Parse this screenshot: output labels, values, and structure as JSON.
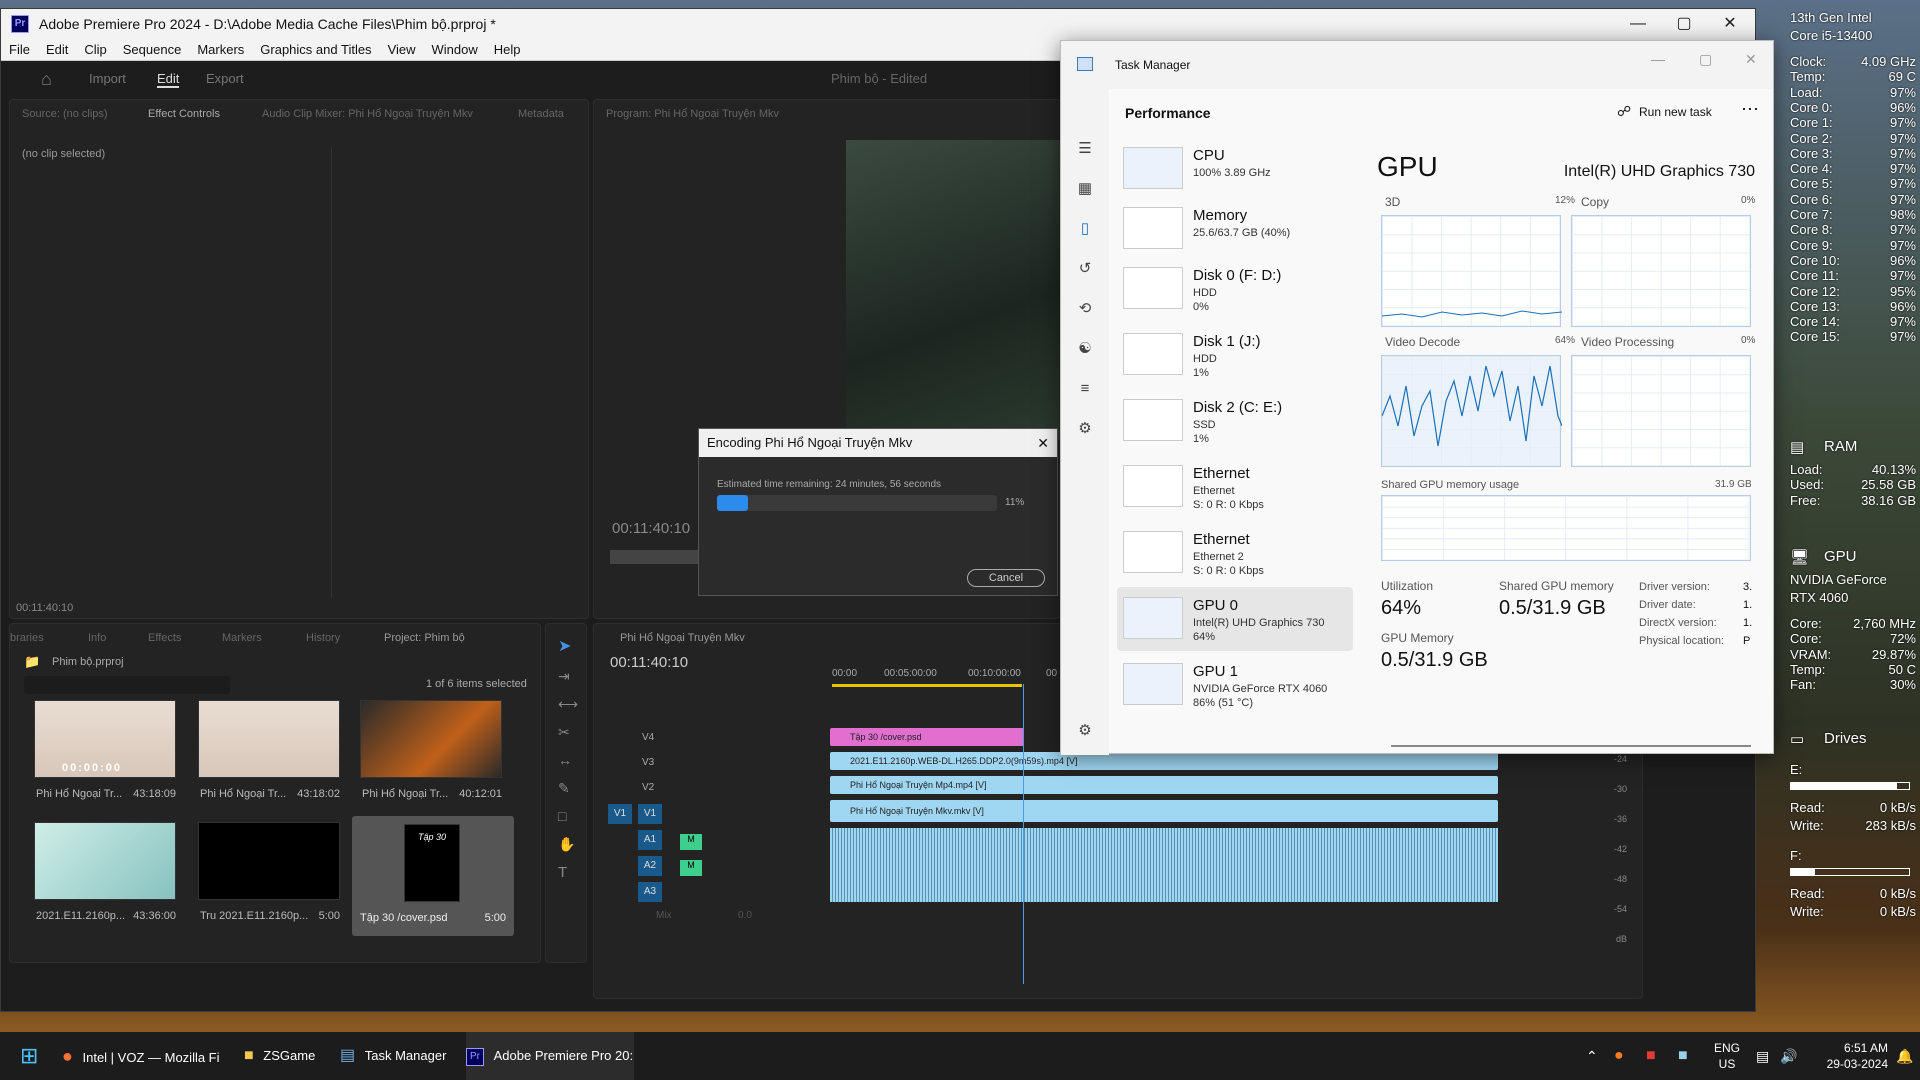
{
  "premiere": {
    "title": "Adobe Premiere Pro 2024 - D:\\Adobe Media Cache Files\\Phim bộ.prproj *",
    "logo": "Pr",
    "menu": [
      "File",
      "Edit",
      "Clip",
      "Sequence",
      "Markers",
      "Graphics and Titles",
      "View",
      "Window",
      "Help"
    ],
    "workspace_tabs": [
      "Import",
      "Edit",
      "Export"
    ],
    "project_title": "Phim bộ - Edited",
    "source_tabs": [
      "Source: (no clips)",
      "Effect Controls",
      "Audio Clip Mixer: Phi Hổ Ngoại Truyện Mkv",
      "Metadata"
    ],
    "no_clip": "(no clip selected)",
    "program_tab": "Program: Phi Hổ Ngoại Truyện Mkv",
    "program_timecode": "00:11:40:10",
    "effect_timecode": "00:11:40:10",
    "project_tabs": [
      "braries",
      "Info",
      "Effects",
      "Markers",
      "History",
      "Project: Phim bộ"
    ],
    "project_file": "Phim bộ.prproj",
    "selection_info": "1 of 6 items selected",
    "clips": [
      {
        "name": "Phi Hổ Ngoại Tr...",
        "dur": "43:18:09",
        "thumb_tc": "00:00:00"
      },
      {
        "name": "Phi Hổ Ngoại Tr...",
        "dur": "43:18:02"
      },
      {
        "name": "Phi Hổ Ngoại Tr...",
        "dur": "40:12:01"
      },
      {
        "name": "2021.E11.2160p...",
        "dur": "43:36:00"
      },
      {
        "name": "Tru 2021.E11.2160p...",
        "dur": "5:00"
      },
      {
        "name": "Tập 30 /cover.psd",
        "dur": "5:00",
        "thumb_text": "Tập 30"
      }
    ],
    "timeline_tab": "Phi Hổ Ngoại Truyện Mkv",
    "timeline_timecode": "00:11:40:10",
    "ruler": [
      "00:00",
      "00:05:00:00",
      "00:10:00:00",
      "00"
    ],
    "tracks": [
      {
        "name": "V4",
        "clip": "Tập 30 /cover.psd",
        "color": "#e06fd0"
      },
      {
        "name": "V3",
        "clip": "2021.E11.2160p.WEB-DL.H265.DDP2.0(9m59s).mp4 [V]",
        "color": "#9fd6f2"
      },
      {
        "name": "V2",
        "clip": "Phi Hổ Ngoại Truyện Mp4.mp4 [V]",
        "color": "#9fd6f2"
      },
      {
        "name": "V1",
        "clip": "Phi Hổ Ngoại Truyện Mkv.mkv [V]",
        "color": "#9fd6f2"
      }
    ],
    "audio_tracks": [
      "A1",
      "A2",
      "A3"
    ],
    "mix_label": "Mix",
    "mix_value": "0.0",
    "meter_labels": [
      "-24",
      "-30",
      "-36",
      "-42",
      "-48",
      "-54",
      "dB"
    ]
  },
  "encoding": {
    "title": "Encoding Phi Hổ Ngoại Truyện Mkv",
    "time_remaining": "Estimated time remaining: 24 minutes, 56 seconds",
    "progress": 11,
    "progress_label": "11%",
    "cancel": "Cancel"
  },
  "taskmgr": {
    "title": "Task Manager",
    "section": "Performance",
    "run_task": "Run new task",
    "items": [
      {
        "name": "CPU",
        "s1": "100% 3.89 GHz",
        "s2": ""
      },
      {
        "name": "Memory",
        "s1": "25.6/63.7 GB (40%)",
        "s2": ""
      },
      {
        "name": "Disk 0 (F: D:)",
        "s1": "HDD",
        "s2": "0%"
      },
      {
        "name": "Disk 1 (J:)",
        "s1": "HDD",
        "s2": "1%"
      },
      {
        "name": "Disk 2 (C: E:)",
        "s1": "SSD",
        "s2": "1%"
      },
      {
        "name": "Ethernet",
        "s1": "Ethernet",
        "s2": "S: 0 R: 0 Kbps"
      },
      {
        "name": "Ethernet",
        "s1": "Ethernet 2",
        "s2": "S: 0 R: 0 Kbps"
      },
      {
        "name": "GPU 0",
        "s1": "Intel(R) UHD Graphics 730",
        "s2": "64%"
      },
      {
        "name": "GPU 1",
        "s1": "NVIDIA GeForce RTX 4060",
        "s2": "86% (51 °C)"
      }
    ],
    "gpu_heading": "GPU",
    "gpu_model": "Intel(R) UHD Graphics 730",
    "graphs": [
      {
        "label": "3D",
        "pct": "12%"
      },
      {
        "label": "Copy",
        "pct": "0%"
      },
      {
        "label": "Video Decode",
        "pct": "64%"
      },
      {
        "label": "Video Processing",
        "pct": "0%"
      }
    ],
    "shared_label": "Shared GPU memory usage",
    "shared_max": "31.9 GB",
    "utilization_label": "Utilization",
    "utilization": "64%",
    "shared_mem_label": "Shared GPU memory",
    "shared_mem": "0.5/31.9 GB",
    "gpu_mem_label": "GPU Memory",
    "gpu_mem": "0.5/31.9 GB",
    "details": [
      {
        "k": "Driver version:",
        "v": "3."
      },
      {
        "k": "Driver date:",
        "v": "1."
      },
      {
        "k": "DirectX version:",
        "v": "1."
      },
      {
        "k": "Physical location:",
        "v": "P"
      }
    ]
  },
  "overlay": {
    "cpu_name1": "13th Gen Intel",
    "cpu_name2": "Core i5-13400",
    "cpu_stats": [
      {
        "k": "Clock:",
        "v": "4.09 GHz"
      },
      {
        "k": "Temp:",
        "v": "69 C"
      },
      {
        "k": "Load:",
        "v": "97%"
      },
      {
        "k": "Core 0:",
        "v": "96%"
      },
      {
        "k": "Core 1:",
        "v": "97%"
      },
      {
        "k": "Core 2:",
        "v": "97%"
      },
      {
        "k": "Core 3:",
        "v": "97%"
      },
      {
        "k": "Core 4:",
        "v": "97%"
      },
      {
        "k": "Core 5:",
        "v": "97%"
      },
      {
        "k": "Core 6:",
        "v": "97%"
      },
      {
        "k": "Core 7:",
        "v": "98%"
      },
      {
        "k": "Core 8:",
        "v": "97%"
      },
      {
        "k": "Core 9:",
        "v": "97%"
      },
      {
        "k": "Core 10:",
        "v": "96%"
      },
      {
        "k": "Core 11:",
        "v": "97%"
      },
      {
        "k": "Core 12:",
        "v": "95%"
      },
      {
        "k": "Core 13:",
        "v": "96%"
      },
      {
        "k": "Core 14:",
        "v": "97%"
      },
      {
        "k": "Core 15:",
        "v": "97%"
      }
    ],
    "ram_heading": "RAM",
    "ram_stats": [
      {
        "k": "Load:",
        "v": "40.13%"
      },
      {
        "k": "Used:",
        "v": "25.58 GB"
      },
      {
        "k": "Free:",
        "v": "38.16 GB"
      }
    ],
    "gpu_heading": "GPU",
    "gpu_name1": "NVIDIA GeForce",
    "gpu_name2": "RTX 4060",
    "gpu_stats": [
      {
        "k": "Core:",
        "v": "2,760 MHz"
      },
      {
        "k": "Core:",
        "v": "72%"
      },
      {
        "k": "VRAM:",
        "v": "29.87%"
      },
      {
        "k": "Temp:",
        "v": "50 C"
      },
      {
        "k": "Fan:",
        "v": "30%"
      }
    ],
    "drives_heading": "Drives",
    "drives": [
      {
        "letter": "E:",
        "fill": 0.9,
        "read": "0 kB/s",
        "write": "283 kB/s"
      },
      {
        "letter": "F:",
        "fill": 0.2,
        "read": "0 kB/s",
        "write": "0 kB/s"
      }
    ],
    "read_label": "Read:",
    "write_label": "Write:"
  },
  "taskbar": {
    "apps": [
      {
        "label": "Intel | VOZ — Mozilla Fi"
      },
      {
        "label": "ZSGame"
      },
      {
        "label": "Task Manager"
      },
      {
        "label": "Adobe Premiere Pro 20:"
      }
    ],
    "lang1": "ENG",
    "lang2": "US",
    "time": "6:51 AM",
    "date": "29-03-2024"
  },
  "colors": {
    "accent": "#2d8ceb",
    "pr_purple": "#9999ff",
    "v4_clip": "#e06fd0",
    "video_clip": "#9fd6f2",
    "tm_graph": "#1c6fb7"
  }
}
